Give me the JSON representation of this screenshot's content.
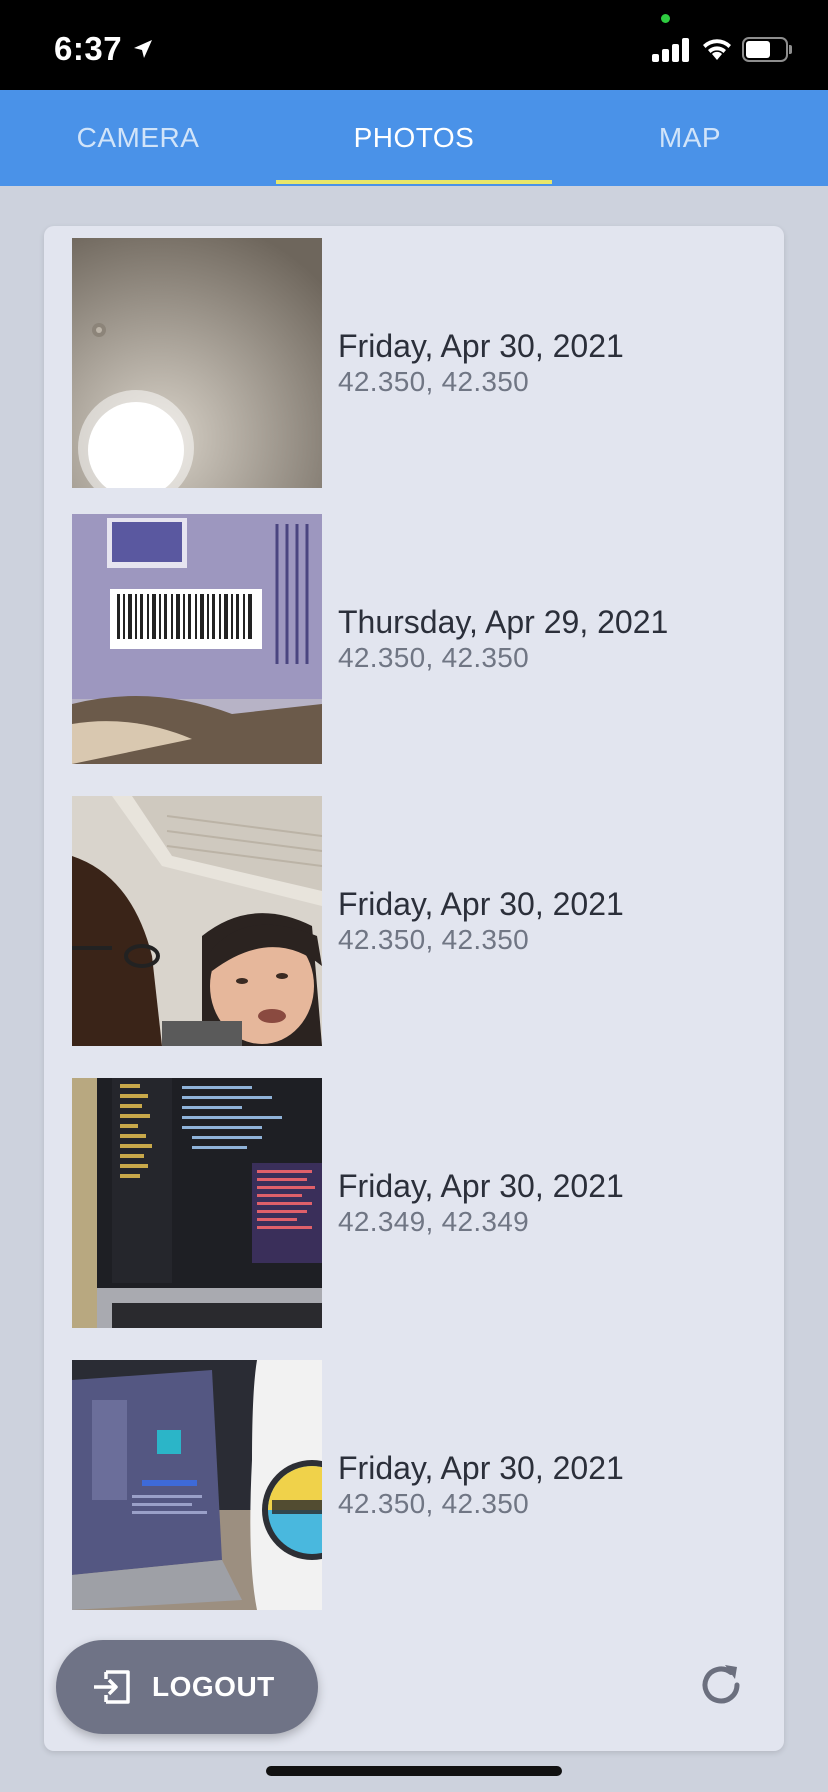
{
  "status_bar": {
    "time": "6:37",
    "icons": [
      "location-arrow-icon",
      "signal-icon",
      "wifi-icon",
      "battery-icon"
    ]
  },
  "tabs": [
    {
      "label": "CAMERA",
      "active": false
    },
    {
      "label": "PHOTOS",
      "active": true
    },
    {
      "label": "MAP",
      "active": false
    }
  ],
  "photos": [
    {
      "date": "Friday, Apr 30, 2021",
      "coords": "42.350, 42.350"
    },
    {
      "date": "Thursday, Apr 29, 2021",
      "coords": "42.350, 42.350"
    },
    {
      "date": "Friday, Apr 30, 2021",
      "coords": "42.350, 42.350"
    },
    {
      "date": "Friday, Apr 30, 2021",
      "coords": "42.349, 42.349"
    },
    {
      "date": "Friday, Apr 30, 2021",
      "coords": "42.350, 42.350"
    }
  ],
  "actions": {
    "logout_label": "LOGOUT",
    "refresh_icon": "refresh-icon"
  },
  "colors": {
    "tab_bar": "#4a92e8",
    "tab_indicator": "#e8e66a",
    "card": "#e2e5ef",
    "background": "#cdd2dd",
    "logout_button": "#6f7386"
  }
}
